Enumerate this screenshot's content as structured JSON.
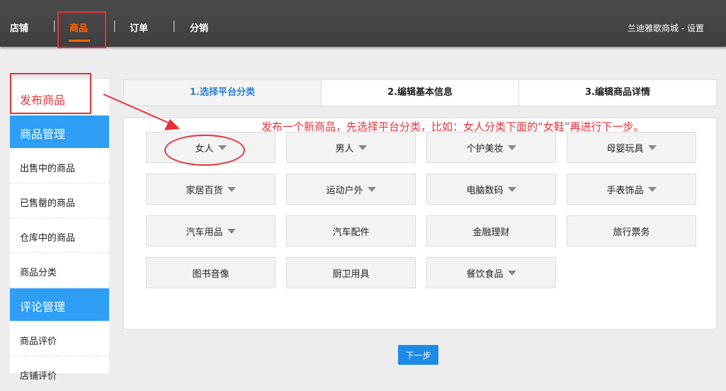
{
  "topnav": {
    "items": [
      {
        "label": "店铺",
        "active": false
      },
      {
        "label": "商品",
        "active": true
      },
      {
        "label": "订单",
        "active": false
      },
      {
        "label": "分销",
        "active": false
      }
    ],
    "separator": "|",
    "store_link": "兰迪雅歌商城 - 设置"
  },
  "sidebar": {
    "publish": "发布商品",
    "sections": [
      {
        "title": "商品管理",
        "items": [
          "出售中的商品",
          "已售罄的商品",
          "仓库中的商品",
          "商品分类"
        ]
      },
      {
        "title": "评论管理",
        "items": [
          "商品评价",
          "店铺评价"
        ]
      }
    ]
  },
  "steps": [
    "1.选择平台分类",
    "2.编辑基本信息",
    "3.编辑商品详情"
  ],
  "annotation": "发布一个新商品，先选择平台分类，比如：女人分类下面的“女鞋”再进行下一步。",
  "categories": [
    {
      "label": "女人",
      "dropdown": true
    },
    {
      "label": "男人",
      "dropdown": true
    },
    {
      "label": "个护美妆",
      "dropdown": true
    },
    {
      "label": "母婴玩具",
      "dropdown": true
    },
    {
      "label": "家居百货",
      "dropdown": true
    },
    {
      "label": "运动户外",
      "dropdown": true
    },
    {
      "label": "电脑数码",
      "dropdown": true
    },
    {
      "label": "手表饰品",
      "dropdown": true
    },
    {
      "label": "汽车用品",
      "dropdown": true
    },
    {
      "label": "汽车配件",
      "dropdown": false
    },
    {
      "label": "金融理财",
      "dropdown": false
    },
    {
      "label": "旅行票务",
      "dropdown": false
    },
    {
      "label": "图书音像",
      "dropdown": false
    },
    {
      "label": "厨卫用具",
      "dropdown": false
    },
    {
      "label": "餐饮食品",
      "dropdown": true
    }
  ],
  "next_button": "下一步",
  "colors": {
    "accent": "#ff6600",
    "primary": "#2f9ef5",
    "annotation": "#e8313a",
    "topbar": "#474747"
  }
}
